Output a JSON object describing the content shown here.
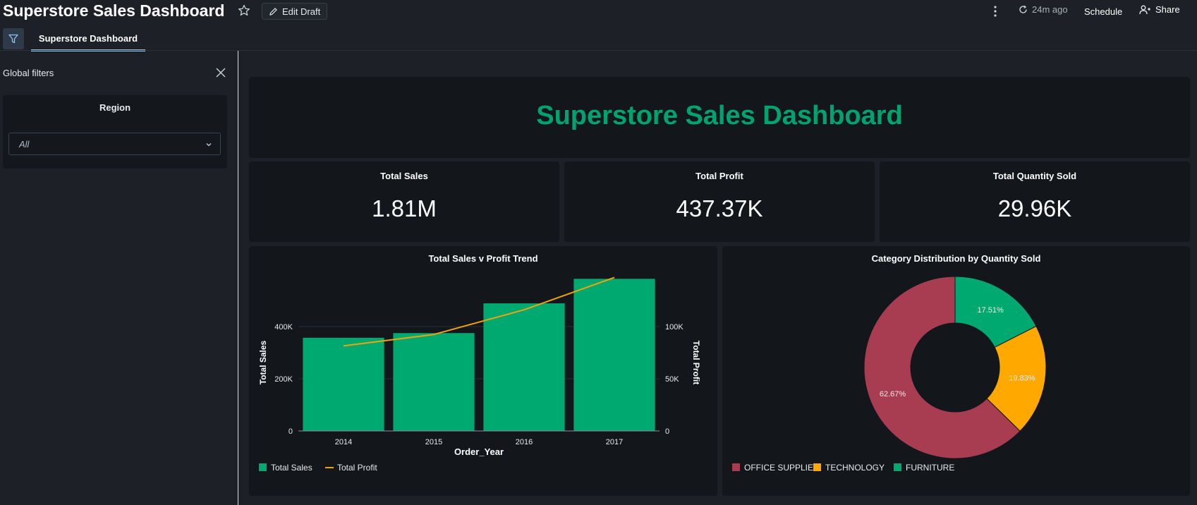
{
  "header": {
    "title": "Superstore Sales Dashboard",
    "edit_label": "Edit Draft",
    "refresh_label": "24m ago",
    "schedule_label": "Schedule",
    "share_label": "Share"
  },
  "tabs": [
    {
      "label": "Superstore Dashboard",
      "active": true
    }
  ],
  "filters": {
    "title": "Global filters",
    "region": {
      "label": "Region",
      "value": "All"
    }
  },
  "dashboard": {
    "title": "Superstore Sales Dashboard",
    "title_color": "#00a36e",
    "kpis": [
      {
        "title": "Total Sales",
        "value": "1.81M"
      },
      {
        "title": "Total Profit",
        "value": "437.37K"
      },
      {
        "title": "Total Quantity Sold",
        "value": "29.96K"
      }
    ]
  },
  "colors": {
    "accent_green": "#00a96f",
    "profit_line": "#f0a30a",
    "office_supplies": "#a83d52",
    "technology": "#ffa800",
    "furniture": "#00a96f",
    "tab_underline": "#8fc3ea"
  },
  "chart_data": [
    {
      "type": "bar",
      "title": "Total Sales v Profit Trend",
      "xlabel": "Order_Year",
      "ylabel": "Total Sales",
      "y2label": "Total Profit",
      "categories": [
        "2014",
        "2015",
        "2016",
        "2017"
      ],
      "ylim": [
        0,
        600000
      ],
      "y2lim": [
        0,
        150000
      ],
      "yticks": [
        {
          "v": 0,
          "t": "0"
        },
        {
          "v": 200000,
          "t": "200K"
        },
        {
          "v": 400000,
          "t": "400K"
        }
      ],
      "y2ticks": [
        {
          "v": 0,
          "t": "0"
        },
        {
          "v": 50000,
          "t": "50K"
        },
        {
          "v": 100000,
          "t": "100K"
        }
      ],
      "series": [
        {
          "name": "Total Sales",
          "kind": "bar",
          "axis": "left",
          "values": [
            357000,
            375000,
            489000,
            583000
          ]
        },
        {
          "name": "Total Profit",
          "kind": "line",
          "axis": "right",
          "values": [
            81500,
            92400,
            116100,
            147000
          ]
        }
      ],
      "legend": "bottom-left",
      "grid": true
    },
    {
      "type": "pie",
      "donut": true,
      "title": "Category Distribution by Quantity Sold",
      "labels": [
        "OFFICE SUPPLIES",
        "TECHNOLOGY",
        "FURNITURE"
      ],
      "values": [
        62.67,
        19.83,
        17.51
      ],
      "value_labels": [
        "62.67%",
        "19.83%",
        "17.51%"
      ],
      "legend": "bottom-left"
    }
  ]
}
